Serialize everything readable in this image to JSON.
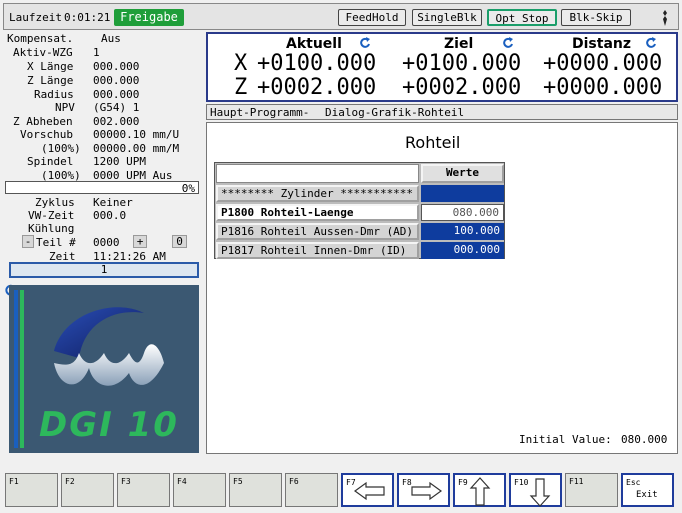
{
  "header": {
    "runtime_label": "Laufzeit",
    "runtime_value": "0:01:21",
    "release_badge": "Freigabe",
    "buttons": [
      "FeedHold",
      "SingleBlk",
      "Opt Stop",
      "Blk-Skip"
    ],
    "colors": {
      "release": "#1f9e3a",
      "active_outline": "#1a9e6a"
    }
  },
  "status": [
    {
      "label": "Kompensat.",
      "value": "Aus"
    },
    {
      "label": "Aktiv-WZG",
      "value": "1"
    },
    {
      "label": "X Länge",
      "value": "000.000"
    },
    {
      "label": "Z Länge",
      "value": "000.000"
    },
    {
      "label": "Radius",
      "value": "000.000"
    },
    {
      "label": "NPV",
      "value": "(G54) 1"
    },
    {
      "label": "Z Abheben",
      "value": "002.000"
    },
    {
      "label": "Vorschub",
      "value": "00000.10 mm/U"
    },
    {
      "label": "(100%)",
      "value": "00000.00 mm/M"
    },
    {
      "label": "Spindel",
      "value": "1200 UPM"
    },
    {
      "label": "(100%)",
      "value": "0000 UPM Aus"
    }
  ],
  "progress": {
    "percent_label": "0%",
    "fraction": 0.0
  },
  "cycle": [
    {
      "label": "Zyklus",
      "value": "Keiner"
    },
    {
      "label": "VW-Zeit",
      "value": "000.0"
    },
    {
      "label": "Kühlung",
      "value": ""
    }
  ],
  "part_counter": {
    "minus": "-",
    "label": "Teil #",
    "value": "0000",
    "plus": "+",
    "extra": "0"
  },
  "time": {
    "label": "Zeit",
    "value": "11:21:26 AM"
  },
  "block_number": "1",
  "logo_text": "DGI 10",
  "coords": {
    "headers": [
      "Aktuell",
      "Ziel",
      "Distanz"
    ],
    "rows": [
      {
        "axis": "X",
        "actual": "+0100.000",
        "target": "+0100.000",
        "distance": "+0000.000"
      },
      {
        "axis": "Z",
        "actual": "+0002.000",
        "target": "+0002.000",
        "distance": "+0000.000"
      }
    ]
  },
  "breadcrumb": [
    "Haupt-Programm-",
    "Dialog-Grafik-Rohteil"
  ],
  "panel": {
    "title": "Rohteil",
    "column_header": "Werte",
    "rows": [
      {
        "label": "******** Zylinder ***********",
        "value": ""
      },
      {
        "label": "P1800 Rohteil-Laenge",
        "value": "080.000"
      },
      {
        "label": "P1816 Rohteil Aussen-Dmr (AD)",
        "value": "100.000"
      },
      {
        "label": "P1817 Rohteil Innen-Dmr (ID)",
        "value": "000.000"
      }
    ],
    "initial_value_label": "Initial Value:",
    "initial_value": "080.000"
  },
  "fkeys": [
    {
      "key": "F1",
      "label": ""
    },
    {
      "key": "F2",
      "label": ""
    },
    {
      "key": "F3",
      "label": ""
    },
    {
      "key": "F4",
      "label": ""
    },
    {
      "key": "F5",
      "label": ""
    },
    {
      "key": "F6",
      "label": ""
    },
    {
      "key": "F7",
      "label": "",
      "icon": "arrow-left-icon"
    },
    {
      "key": "F8",
      "label": "",
      "icon": "arrow-right-icon"
    },
    {
      "key": "F9",
      "label": "",
      "icon": "arrow-up-icon"
    },
    {
      "key": "F10",
      "label": "",
      "icon": "arrow-down-icon"
    },
    {
      "key": "F11",
      "label": ""
    },
    {
      "key": "Esc",
      "label": "Exit"
    }
  ]
}
